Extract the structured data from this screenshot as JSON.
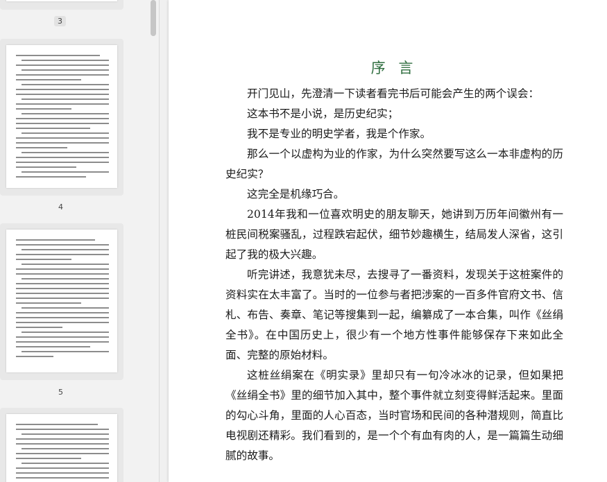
{
  "sidebar": {
    "pages": [
      {
        "number": "3",
        "selected": true
      },
      {
        "number": "4",
        "selected": false
      },
      {
        "number": "5",
        "selected": false
      }
    ]
  },
  "document": {
    "title": "序 言",
    "paragraphs": [
      "开门见山，先澄清一下读者看完书后可能会产生的两个误会：",
      "这本书不是小说，是历史纪实；",
      "我不是专业的明史学者，我是个作家。",
      "那么一个以虚构为业的作家，为什么突然要写这么一本非虚构的历史纪实？",
      "这完全是机缘巧合。",
      "2014年我和一位喜欢明史的朋友聊天，她讲到万历年间徽州有一桩民间税案骚乱，过程跌宕起伏，细节妙趣横生，结局发人深省，这引起了我的极大兴趣。",
      "听完讲述，我意犹未尽，去搜寻了一番资料，发现关于这桩案件的资料实在太丰富了。当时的一位参与者把涉案的一百多件官府文书、信札、布告、奏章、笔记等搜集到一起，编纂成了一本合集，叫作《丝绢全书》。在中国历史上，很少有一个地方性事件能够保存下来如此全面、完整的原始材料。",
      "这桩丝绢案在《明实录》里却只有一句冷冰冰的记录，但如果把《丝绢全书》里的细节加入其中，整个事件就立刻变得鲜活起来。里面的勾心斗角，里面的人心百态，当时官场和民间的各种潜规则，简直比电视剧还精彩。我们看到的，是一个个有血有肉的人，是一篇篇生动细腻的故事。"
    ]
  }
}
